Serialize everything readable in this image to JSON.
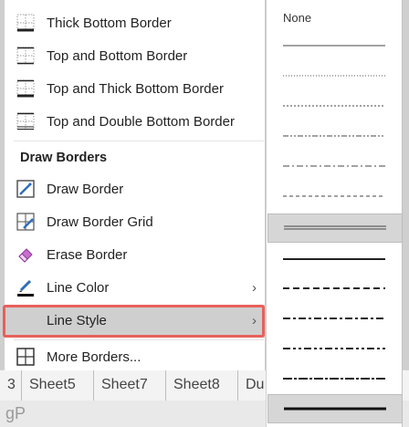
{
  "menu": {
    "items": [
      {
        "label": "Thick Bottom Border",
        "icon": "thick-bottom-border-icon"
      },
      {
        "label": "Top and Bottom Border",
        "icon": "top-bottom-border-icon"
      },
      {
        "label": "Top and Thick Bottom Border",
        "icon": "top-thick-bottom-border-icon"
      },
      {
        "label": "Top and Double Bottom Border",
        "icon": "top-double-bottom-border-icon"
      }
    ],
    "section_heading": "Draw Borders",
    "draw_items": [
      {
        "label": "Draw Border",
        "icon": "draw-border-icon"
      },
      {
        "label": "Draw Border Grid",
        "icon": "draw-border-grid-icon"
      },
      {
        "label": "Erase Border",
        "icon": "eraser-icon"
      },
      {
        "label": "Line Color",
        "icon": "pen-color-icon"
      },
      {
        "label": "Line Style",
        "icon": ""
      },
      {
        "label": "More Borders...",
        "icon": "all-borders-icon"
      }
    ],
    "chevron": "›"
  },
  "submenu": {
    "none_label": "None",
    "styles": [
      "thin",
      "hair",
      "dotted",
      "dash-dot-dot",
      "dash-dot",
      "double",
      "medium",
      "medium-dashed",
      "medium-dash-dot",
      "medium-dash-dot-dot",
      "slanted-dash-dot",
      "thick"
    ],
    "selected": [
      "double",
      "thick"
    ]
  },
  "sheet_tabs": [
    "3",
    "Sheet5",
    "Sheet7",
    "Sheet8",
    "Du"
  ],
  "watermark": "gP",
  "colors": {
    "highlight_border": "#e8605a",
    "selected_bg": "#cfcfcf"
  }
}
